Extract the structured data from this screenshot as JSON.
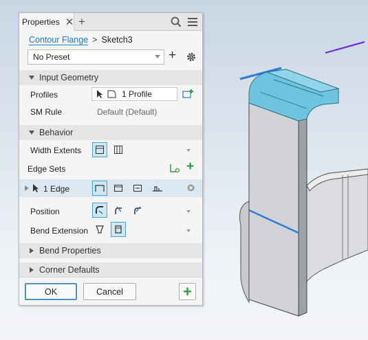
{
  "panel": {
    "tab_label": "Properties",
    "breadcrumb": {
      "feature": "Contour Flange",
      "separator": ">",
      "sketch": "Sketch3"
    },
    "preset": {
      "value": "No Preset"
    },
    "sections": {
      "input_geometry": "Input Geometry",
      "behavior": "Behavior",
      "bend_properties": "Bend Properties",
      "corner_defaults": "Corner Defaults"
    },
    "fields": {
      "profiles_label": "Profiles",
      "profiles_value": "1 Profile",
      "sm_rule_label": "SM Rule",
      "sm_rule_value": "Default (Default)",
      "width_extents_label": "Width Extents",
      "edge_sets_label": "Edge Sets",
      "edge_value": "1 Edge",
      "position_label": "Position",
      "bend_extension_label": "Bend Extension"
    },
    "buttons": {
      "ok": "OK",
      "cancel": "Cancel"
    }
  },
  "colors": {
    "accent": "#1a7bb8",
    "selected_bg": "#cfe6f3",
    "add_green": "#2e9e3a",
    "model_highlight": "#6ec3df",
    "edge_blue": "#2b7bd6",
    "sketch_purple": "#6a2bd0"
  },
  "icons": [
    "close-icon",
    "add-tab-icon",
    "search-icon",
    "menu-icon",
    "add-preset-icon",
    "gear-icon",
    "cursor-icon",
    "profile-icon",
    "add-profile-icon",
    "width-extents-icon",
    "edge-chain-icon",
    "add-edge-set-icon",
    "info-icon"
  ]
}
